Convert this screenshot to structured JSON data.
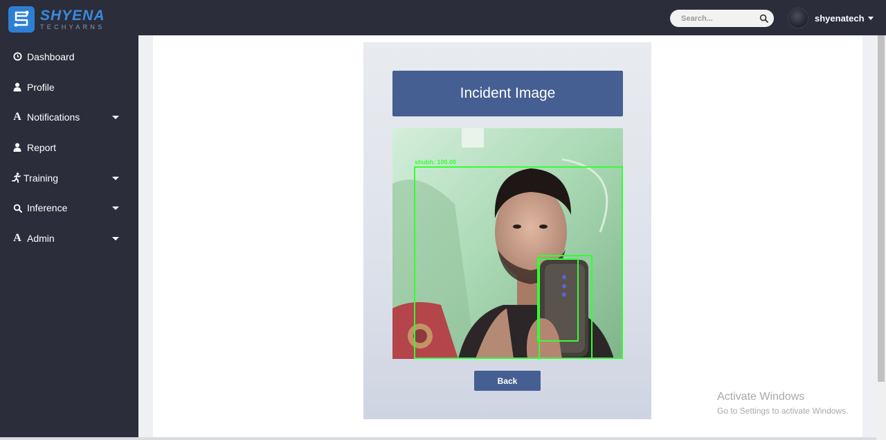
{
  "brand": {
    "name": "SHYENA",
    "tagline": "TECHYARNS"
  },
  "sidebar": {
    "items": [
      {
        "label": "Dashboard",
        "icon": "clock-icon",
        "has_submenu": false
      },
      {
        "label": "Profile",
        "icon": "user-icon",
        "has_submenu": false
      },
      {
        "label": "Notifications",
        "icon": "font-icon",
        "has_submenu": true
      },
      {
        "label": "Report",
        "icon": "user-icon",
        "has_submenu": false
      },
      {
        "label": "Training",
        "icon": "running-icon",
        "has_submenu": true
      },
      {
        "label": "Inference",
        "icon": "search-icon",
        "has_submenu": true
      },
      {
        "label": "Admin",
        "icon": "font-icon",
        "has_submenu": true
      }
    ]
  },
  "header": {
    "search": {
      "placeholder": "Search..."
    },
    "user": {
      "name": "shyenatech"
    }
  },
  "card": {
    "title": "Incident Image",
    "image": {
      "detection_label": "shubh: 100.00"
    },
    "back_label": "Back"
  },
  "watermark": {
    "title": "Activate Windows",
    "subtitle": "Go to Settings to activate Windows."
  },
  "colors": {
    "sidebar_bg": "#2b2d3b",
    "accent_blue": "#465f93",
    "brand_blue": "#3a8bdc",
    "detection_box": "#33ff33"
  }
}
